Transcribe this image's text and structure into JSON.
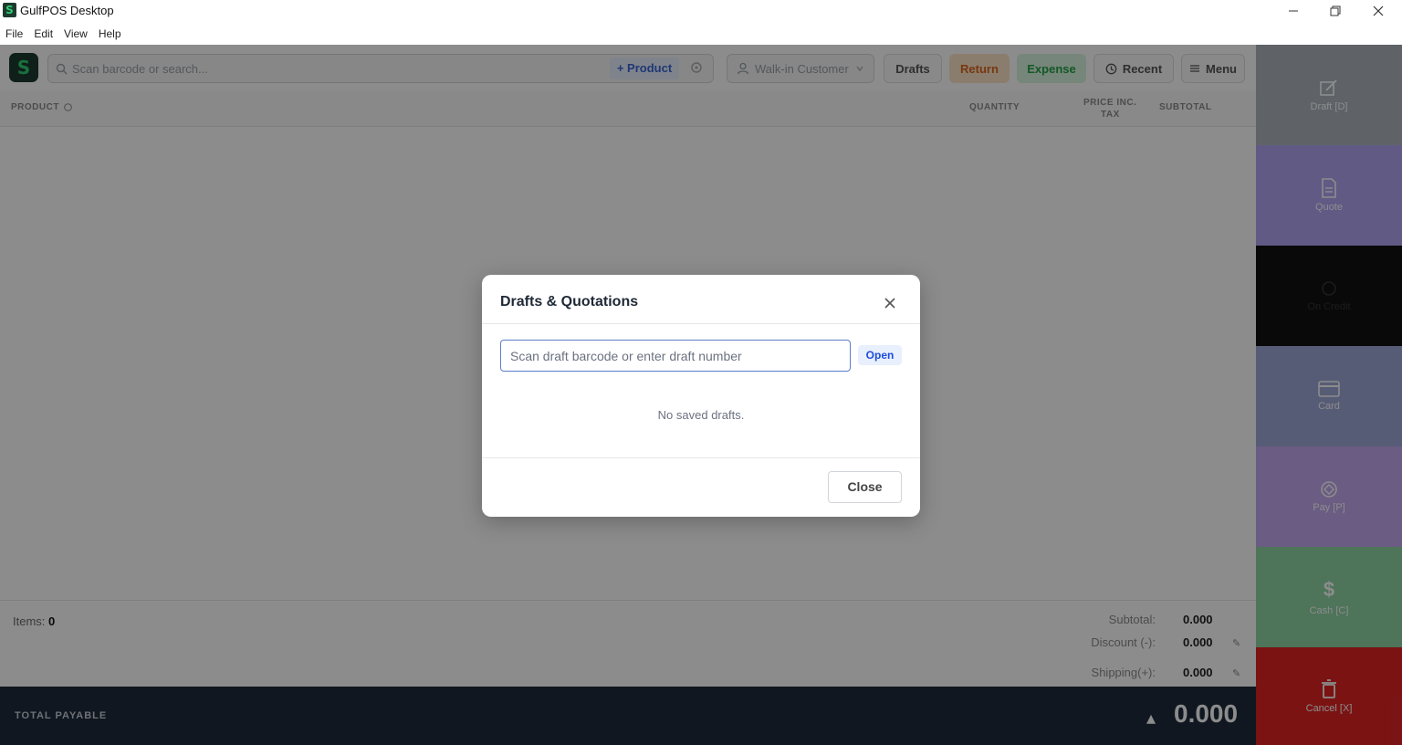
{
  "window": {
    "title": "GulfPOS Desktop",
    "icon_letter": "S"
  },
  "menu": [
    "File",
    "Edit",
    "View",
    "Help"
  ],
  "toolbar": {
    "logo_letter": "S",
    "search_placeholder": "Scan barcode or search...",
    "add_product": "+ Product",
    "customer": "Walk-in Customer",
    "drafts": "Drafts",
    "return": "Return",
    "expense": "Expense",
    "recent": "Recent",
    "menu": "Menu"
  },
  "table": {
    "product": "PRODUCT",
    "quantity": "QUANTITY",
    "price_line1": "PRICE INC.",
    "price_line2": "TAX",
    "subtotal": "SUBTOTAL"
  },
  "totals": {
    "items_label": "Items:",
    "items_value": "0",
    "subtotal_label": "Subtotal:",
    "subtotal_value": "0.000",
    "discount_label": "Discount (-):",
    "discount_value": "0.000",
    "shipping_label": "Shipping(+):",
    "shipping_value": "0.000"
  },
  "payable": {
    "label": "TOTAL PAYABLE",
    "amount": "0.000"
  },
  "side_actions": [
    {
      "label": "Draft [D]",
      "color": "#adb5bd"
    },
    {
      "label": "Quote",
      "color": "#b1a5f3"
    },
    {
      "label": "On Credit",
      "color": "#111111"
    },
    {
      "label": "Card",
      "color": "#9fa8d8"
    },
    {
      "label": "Pay [P]",
      "color": "#c4a8ef"
    },
    {
      "label": "Cash [C]",
      "color": "#8fd3a5"
    },
    {
      "label": "Cancel [X]",
      "color": "#e02424"
    }
  ],
  "modal": {
    "title": "Drafts & Quotations",
    "input_placeholder": "Scan draft barcode or enter draft number",
    "open_button": "Open",
    "empty_message": "No saved drafts.",
    "close_button": "Close"
  }
}
